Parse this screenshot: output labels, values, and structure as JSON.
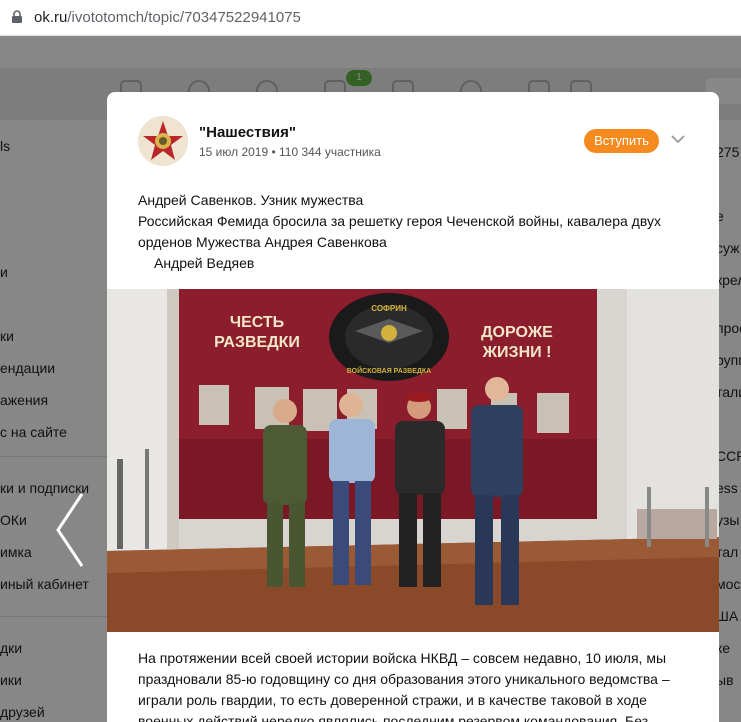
{
  "browser": {
    "url_host": "ok.ru",
    "url_path": "/ivototomch/topic/70347522941075"
  },
  "topnav": {
    "badge_count": "1"
  },
  "left_menu": {
    "items": [
      "ls",
      "и",
      "ки",
      "ендации",
      "ажения",
      "с на сайте",
      "ки и подписки",
      " ОКи",
      "имка",
      "иный кабинет",
      "дки",
      "ики",
      "друзей"
    ]
  },
  "right_menu": {
    "items": [
      "275",
      "е",
      "суж",
      "крел",
      "прос",
      "рупп",
      "тали",
      "ССР",
      "ess",
      "узы",
      "тал",
      "мос",
      "ША",
      "ке",
      "ыв"
    ]
  },
  "post": {
    "group_name": "\"Нашествия\"",
    "group_meta": "15 июл 2019 • 110 344 участника",
    "join_label": "Вступить",
    "lines": [
      "Андрей Савенков. Узник мужества",
      "Российская Фемида бросила за решетку героя Чеченской войны, кавалера двух",
      "орденов Мужества Андрея Савенкова",
      "Андрей Ведяев"
    ],
    "photo_banner_left": [
      "ЧЕСТЬ",
      "РАЗВЕДКИ"
    ],
    "photo_banner_right": [
      "ДОРОЖЕ",
      "ЖИЗНИ !"
    ],
    "photo_emblem_top": "СОФРИН",
    "photo_emblem_bottom": "ВОЙСКОВАЯ РАЗВЕДКА",
    "body_lines": [
      "На протяжении всей своей истории войска НКВД – совсем недавно, 10 июля, мы",
      "праздновали 85-ю годовщину со дня образования этого уникального ведомства –",
      "играли роль гвардии, то есть доверенной стражи, и в качестве таковой в ходе",
      "военных действий нередко являлись последним резервом командования. Без"
    ]
  },
  "colors": {
    "accent": "#f58a1f",
    "badge": "#5fb742",
    "banner": "#8b1d2c"
  }
}
